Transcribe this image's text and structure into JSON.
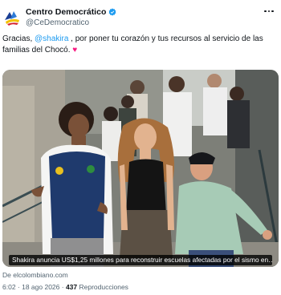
{
  "author": {
    "name": "Centro Democrático",
    "handle": "@CeDemocratico",
    "verified_color": "#1d9bf0"
  },
  "tweet": {
    "text_part1": "Gracias, ",
    "mention": "@shakira",
    "text_part2": " , por poner tu corazón y tus recursos al servicio de las familias del Chocó. ",
    "emoji": "♥"
  },
  "media": {
    "caption": "Shakira anuncia US$1,25 millones para reconstruir escuelas afectadas por el sismo en…",
    "source": "De elcolombiano.com"
  },
  "meta": {
    "time": "6:02",
    "separator1": " · ",
    "date": "18 ago 2026",
    "separator2": " · ",
    "views_count": "437",
    "views_label": " Reproducciones"
  },
  "colors": {
    "accent": "#1d9bf0",
    "heart": "#f91880",
    "secondary_text": "#536471"
  }
}
